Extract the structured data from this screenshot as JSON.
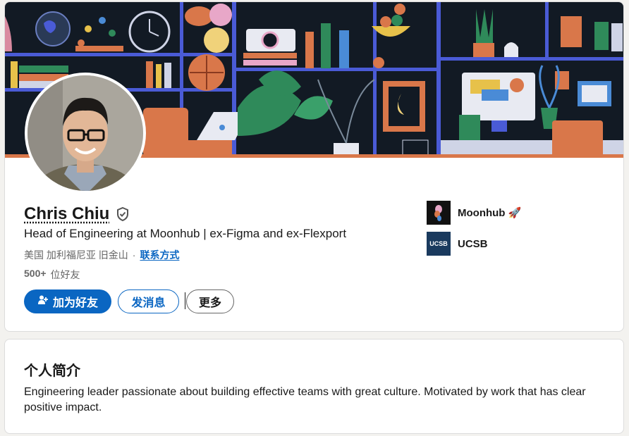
{
  "profile": {
    "name": "Chris Chiu",
    "headline": "Head of Engineering at Moonhub | ex-Figma and ex-Flexport",
    "location": "美国 加利福尼亚 旧金山",
    "separator": "·",
    "contact_link": "联系方式",
    "connections_count": "500+",
    "connections_label": "位好友",
    "icons": {
      "verified": "verified-shield-icon",
      "add_friend": "add-person-icon"
    }
  },
  "actions": {
    "add_friend": "加为好友",
    "message": "发消息",
    "more": "更多"
  },
  "organizations": [
    {
      "name": "Moonhub",
      "emoji": "🚀",
      "logo_text": ""
    },
    {
      "name": "UCSB",
      "emoji": "",
      "logo_text": "UCSB"
    }
  ],
  "about": {
    "title": "个人简介",
    "text": "Engineering leader passionate about building effective teams with great culture. Motivated by work that has clear positive impact."
  },
  "colors": {
    "primary": "#0a66c2",
    "banner_bg": "#121a24",
    "shelf": "#4a5bd6",
    "accent_orange": "#d9774a",
    "accent_green": "#2f8a5a"
  }
}
